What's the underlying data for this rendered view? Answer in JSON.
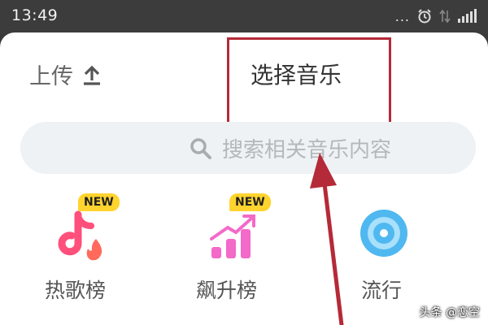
{
  "status_bar": {
    "time": "13:49",
    "more_dots": "..."
  },
  "header": {
    "upload_label": "上传",
    "title": "选择音乐"
  },
  "search": {
    "placeholder": "搜索相关音乐内容"
  },
  "categories": [
    {
      "label": "热歌榜",
      "badge": "NEW",
      "icon": "tiktok-fire-icon"
    },
    {
      "label": "飙升榜",
      "badge": "NEW",
      "icon": "rising-chart-icon"
    },
    {
      "label": "流行",
      "icon": "disc-icon"
    }
  ],
  "watermark": "头条 @恋空",
  "colors": {
    "accent_red": "#b52a38",
    "pink": "#ff4f7b",
    "badge_yellow": "#ffd42e",
    "disc_blue": "#4fb8f0"
  }
}
